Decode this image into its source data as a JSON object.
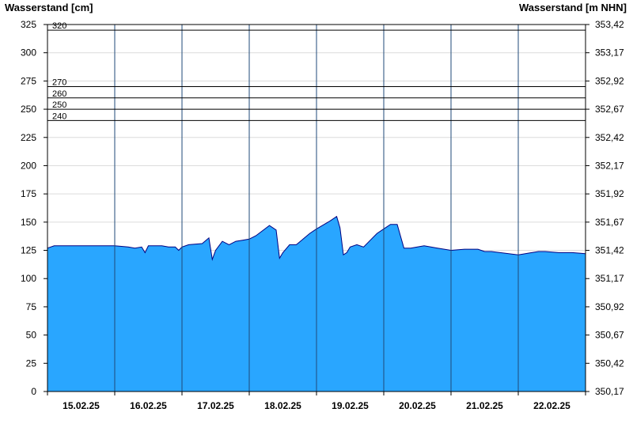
{
  "chart_data": {
    "type": "area",
    "ylabel_left": "Wasserstand [cm]",
    "ylabel_right": "Wasserstand [m NHN]",
    "ylim": [
      0,
      325
    ],
    "yticks_left": [
      0,
      25,
      50,
      75,
      100,
      125,
      150,
      175,
      200,
      225,
      250,
      275,
      300,
      325
    ],
    "yticks_right": [
      "350,17",
      "350,42",
      "350,67",
      "350,92",
      "351,17",
      "351,42",
      "351,67",
      "351,92",
      "352,17",
      "352,42",
      "352,67",
      "352,92",
      "353,17",
      "353,42"
    ],
    "xlim_days": [
      0,
      8
    ],
    "x_tick_labels": [
      "15.02.25",
      "16.02.25",
      "17.02.25",
      "18.02.25",
      "19.02.25",
      "20.02.25",
      "21.02.25",
      "22.02.25"
    ],
    "grid": true,
    "thresholds": [
      {
        "label": "320",
        "value": 320
      },
      {
        "label": "270",
        "value": 270
      },
      {
        "label": "260",
        "value": 260
      },
      {
        "label": "250",
        "value": 250
      },
      {
        "label": "240",
        "value": 240
      }
    ],
    "fill_color": "#29a6ff",
    "line_color": "#000080",
    "series": [
      {
        "x": [
          0.0,
          0.1,
          0.5,
          1.0,
          1.2,
          1.3,
          1.4,
          1.45,
          1.5,
          1.7,
          1.8,
          1.9,
          1.95,
          2.0,
          2.1,
          2.3,
          2.4,
          2.45,
          2.5,
          2.6,
          2.7,
          2.8,
          2.9,
          3.0,
          3.1,
          3.3,
          3.4,
          3.45,
          3.5,
          3.6,
          3.7,
          3.8,
          3.9,
          4.0,
          4.2,
          4.3,
          4.35,
          4.4,
          4.45,
          4.5,
          4.6,
          4.7,
          4.8,
          4.9,
          5.0,
          5.1,
          5.2,
          5.3,
          5.4,
          5.5,
          5.6,
          5.7,
          5.8,
          6.0,
          6.2,
          6.4,
          6.5,
          6.6,
          7.0,
          7.2,
          7.3,
          7.4,
          7.6,
          7.8,
          8.0
        ],
        "values": [
          127,
          129,
          129,
          129,
          128,
          127,
          128,
          123,
          129,
          129,
          128,
          128,
          125,
          128,
          130,
          131,
          136,
          117,
          125,
          133,
          130,
          133,
          134,
          135,
          138,
          147,
          143,
          118,
          123,
          130,
          130,
          135,
          140,
          144,
          151,
          155,
          145,
          121,
          123,
          128,
          130,
          128,
          134,
          140,
          144,
          148,
          148,
          127,
          127,
          128,
          129,
          128,
          127,
          125,
          126,
          126,
          124,
          124,
          121,
          123,
          124,
          124,
          123,
          123,
          122
        ]
      }
    ]
  }
}
